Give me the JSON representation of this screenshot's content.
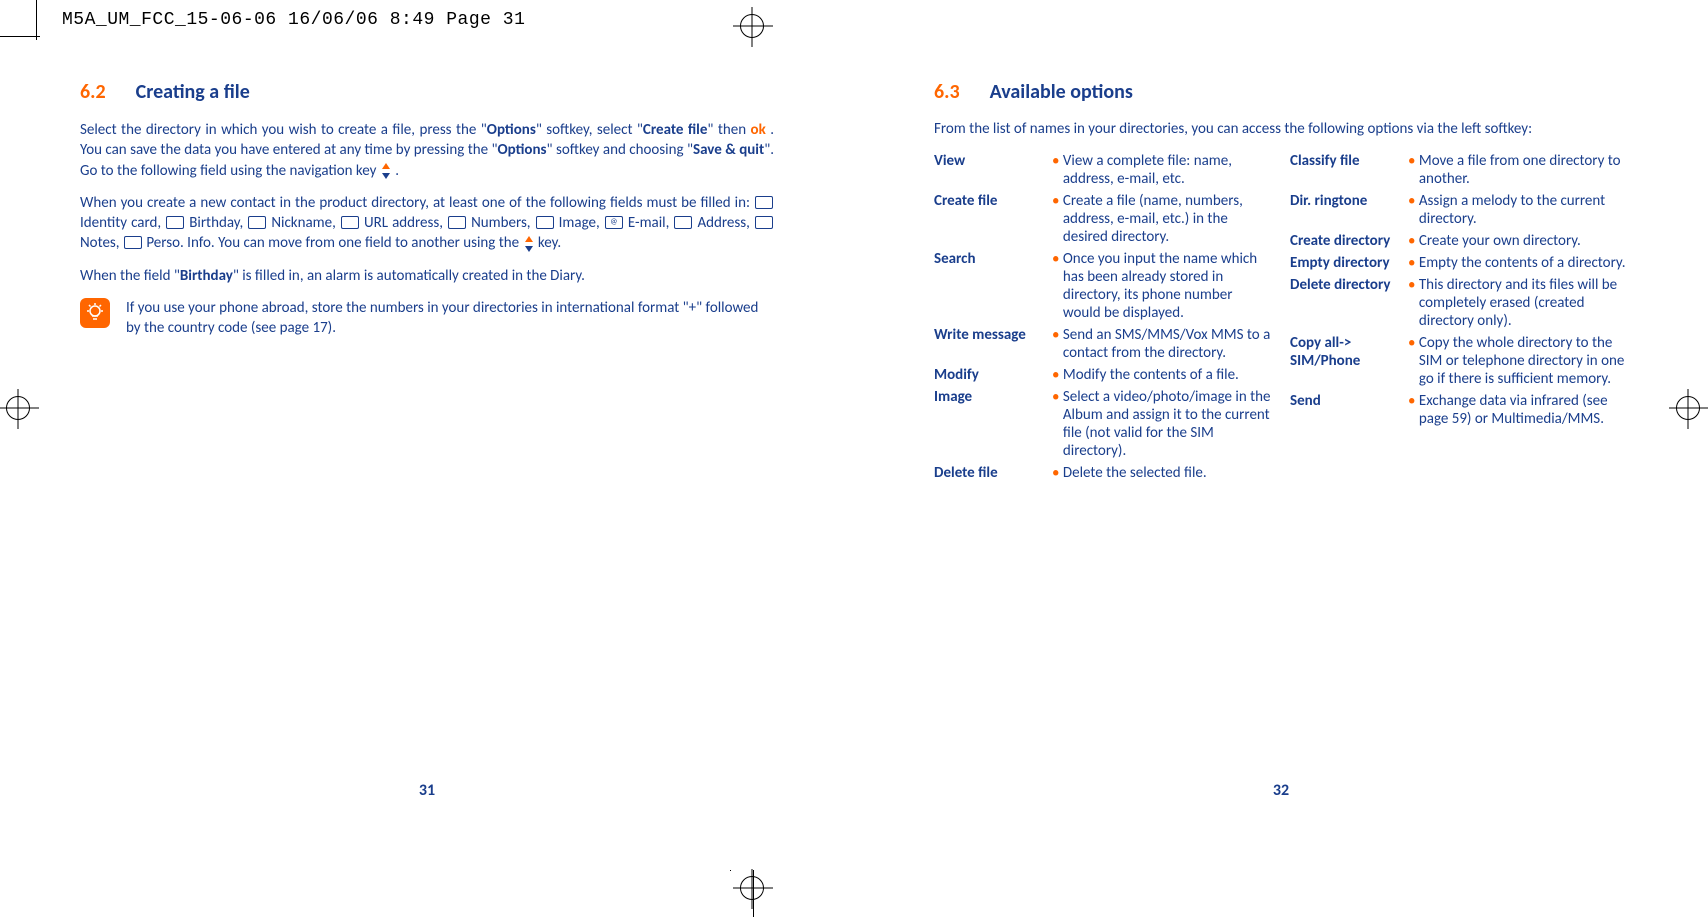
{
  "slug": "M5A_UM_FCC_15-06-06  16/06/06  8:49  Page 31",
  "left": {
    "section_num": "6.2",
    "section_title": "Creating a file",
    "p1a": "Select the directory in which you wish to create a file, press the \"",
    "p1b_bold": "Options",
    "p1c": "\" softkey, select \"",
    "p1d_bold": "Create file",
    "p1e": "\" then ",
    "p1_ok": "ok",
    "p1f": " . You can save the data you have entered at any time by pressing the \"",
    "p1g_bold": "Options",
    "p1h": "\" softkey and choosing \"",
    "p1i_bold": "Save & quit",
    "p1j": "\". Go to the following field using the navigation key ",
    "p1k": " .",
    "p2a": "When you create a new contact in the product directory, at least one of the following fields must be filled in: ",
    "fields": [
      "Identity card,",
      "Birthday,",
      "Nickname,",
      "URL address,",
      "Numbers,",
      "Image,",
      "E-mail,",
      "Address,",
      "Notes,",
      "Perso. Info."
    ],
    "p2b": " You can move from one field to another using the ",
    "p2c": " key.",
    "p3a": "When the field \"",
    "p3b_bold": "Birthday",
    "p3c": "\" is filled in, an alarm is automatically created in the Diary.",
    "tip": "If you use your phone abroad, store the numbers in your directories in international format \"+\" followed by the country code (see page 17).",
    "page_num": "31"
  },
  "right": {
    "section_num": "6.3",
    "section_title": "Available options",
    "intro": "From the list of names in your directories, you can access the following options via the left softkey:",
    "col1": [
      {
        "term": "View",
        "desc": "View a complete file: name, address, e-mail, etc."
      },
      {
        "term": "Create file",
        "desc": "Create a file (name, numbers, address, e-mail, etc.) in the desired directory."
      },
      {
        "term": "Search",
        "desc": "Once you input the name which has been already stored in directory, its phone number would be displayed."
      },
      {
        "term": "Write message",
        "desc": "Send an SMS/MMS/Vox MMS to a contact from the directory."
      },
      {
        "term": "Modify",
        "desc": "Modify the contents of a file."
      },
      {
        "term": "Image",
        "desc": "Select a video/photo/image in the Album and assign it to the current file (not valid for the SIM directory)."
      },
      {
        "term": "Delete file",
        "desc": "Delete the selected file."
      }
    ],
    "col2": [
      {
        "term": "Classify file",
        "desc": "Move a file from one directory to another."
      },
      {
        "term": "Dir. ringtone",
        "desc": "Assign a melody to the current directory."
      },
      {
        "term": "Create directory",
        "desc": "Create your own directory."
      },
      {
        "term": "Empty directory",
        "desc": "Empty the contents of a directory."
      },
      {
        "term": "Delete directory",
        "desc": "This directory and its files will be completely erased (created directory only)."
      },
      {
        "term": "Copy all-> SIM/Phone",
        "desc": "Copy the whole directory to the SIM or telephone directory in one go if there is sufficient memory."
      },
      {
        "term": "Send",
        "desc": "Exchange data via infrared (see page 59) or Multimedia/MMS."
      }
    ],
    "page_num": "32"
  }
}
